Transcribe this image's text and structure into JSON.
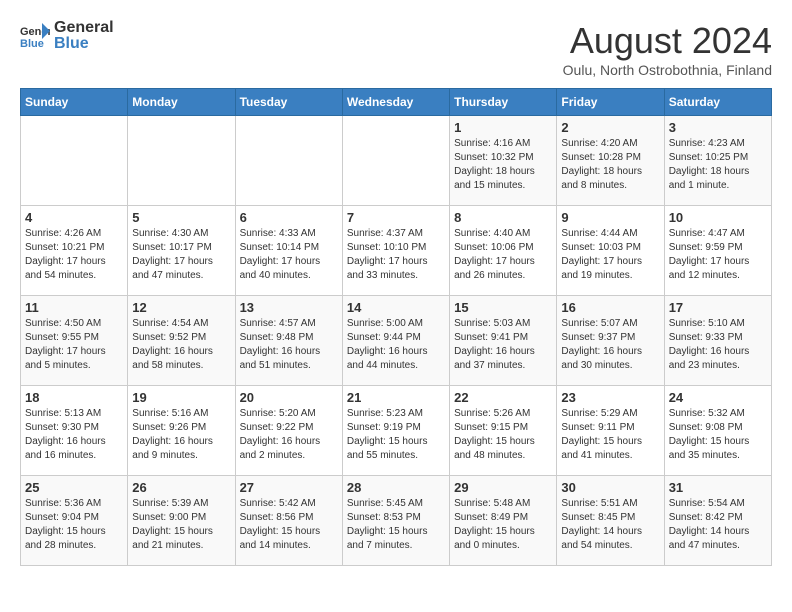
{
  "header": {
    "logo_general": "General",
    "logo_blue": "Blue",
    "title": "August 2024",
    "subtitle": "Oulu, North Ostrobothnia, Finland"
  },
  "weekdays": [
    "Sunday",
    "Monday",
    "Tuesday",
    "Wednesday",
    "Thursday",
    "Friday",
    "Saturday"
  ],
  "weeks": [
    [
      {
        "day": "",
        "info": ""
      },
      {
        "day": "",
        "info": ""
      },
      {
        "day": "",
        "info": ""
      },
      {
        "day": "",
        "info": ""
      },
      {
        "day": "1",
        "info": "Sunrise: 4:16 AM\nSunset: 10:32 PM\nDaylight: 18 hours\nand 15 minutes."
      },
      {
        "day": "2",
        "info": "Sunrise: 4:20 AM\nSunset: 10:28 PM\nDaylight: 18 hours\nand 8 minutes."
      },
      {
        "day": "3",
        "info": "Sunrise: 4:23 AM\nSunset: 10:25 PM\nDaylight: 18 hours\nand 1 minute."
      }
    ],
    [
      {
        "day": "4",
        "info": "Sunrise: 4:26 AM\nSunset: 10:21 PM\nDaylight: 17 hours\nand 54 minutes."
      },
      {
        "day": "5",
        "info": "Sunrise: 4:30 AM\nSunset: 10:17 PM\nDaylight: 17 hours\nand 47 minutes."
      },
      {
        "day": "6",
        "info": "Sunrise: 4:33 AM\nSunset: 10:14 PM\nDaylight: 17 hours\nand 40 minutes."
      },
      {
        "day": "7",
        "info": "Sunrise: 4:37 AM\nSunset: 10:10 PM\nDaylight: 17 hours\nand 33 minutes."
      },
      {
        "day": "8",
        "info": "Sunrise: 4:40 AM\nSunset: 10:06 PM\nDaylight: 17 hours\nand 26 minutes."
      },
      {
        "day": "9",
        "info": "Sunrise: 4:44 AM\nSunset: 10:03 PM\nDaylight: 17 hours\nand 19 minutes."
      },
      {
        "day": "10",
        "info": "Sunrise: 4:47 AM\nSunset: 9:59 PM\nDaylight: 17 hours\nand 12 minutes."
      }
    ],
    [
      {
        "day": "11",
        "info": "Sunrise: 4:50 AM\nSunset: 9:55 PM\nDaylight: 17 hours\nand 5 minutes."
      },
      {
        "day": "12",
        "info": "Sunrise: 4:54 AM\nSunset: 9:52 PM\nDaylight: 16 hours\nand 58 minutes."
      },
      {
        "day": "13",
        "info": "Sunrise: 4:57 AM\nSunset: 9:48 PM\nDaylight: 16 hours\nand 51 minutes."
      },
      {
        "day": "14",
        "info": "Sunrise: 5:00 AM\nSunset: 9:44 PM\nDaylight: 16 hours\nand 44 minutes."
      },
      {
        "day": "15",
        "info": "Sunrise: 5:03 AM\nSunset: 9:41 PM\nDaylight: 16 hours\nand 37 minutes."
      },
      {
        "day": "16",
        "info": "Sunrise: 5:07 AM\nSunset: 9:37 PM\nDaylight: 16 hours\nand 30 minutes."
      },
      {
        "day": "17",
        "info": "Sunrise: 5:10 AM\nSunset: 9:33 PM\nDaylight: 16 hours\nand 23 minutes."
      }
    ],
    [
      {
        "day": "18",
        "info": "Sunrise: 5:13 AM\nSunset: 9:30 PM\nDaylight: 16 hours\nand 16 minutes."
      },
      {
        "day": "19",
        "info": "Sunrise: 5:16 AM\nSunset: 9:26 PM\nDaylight: 16 hours\nand 9 minutes."
      },
      {
        "day": "20",
        "info": "Sunrise: 5:20 AM\nSunset: 9:22 PM\nDaylight: 16 hours\nand 2 minutes."
      },
      {
        "day": "21",
        "info": "Sunrise: 5:23 AM\nSunset: 9:19 PM\nDaylight: 15 hours\nand 55 minutes."
      },
      {
        "day": "22",
        "info": "Sunrise: 5:26 AM\nSunset: 9:15 PM\nDaylight: 15 hours\nand 48 minutes."
      },
      {
        "day": "23",
        "info": "Sunrise: 5:29 AM\nSunset: 9:11 PM\nDaylight: 15 hours\nand 41 minutes."
      },
      {
        "day": "24",
        "info": "Sunrise: 5:32 AM\nSunset: 9:08 PM\nDaylight: 15 hours\nand 35 minutes."
      }
    ],
    [
      {
        "day": "25",
        "info": "Sunrise: 5:36 AM\nSunset: 9:04 PM\nDaylight: 15 hours\nand 28 minutes."
      },
      {
        "day": "26",
        "info": "Sunrise: 5:39 AM\nSunset: 9:00 PM\nDaylight: 15 hours\nand 21 minutes."
      },
      {
        "day": "27",
        "info": "Sunrise: 5:42 AM\nSunset: 8:56 PM\nDaylight: 15 hours\nand 14 minutes."
      },
      {
        "day": "28",
        "info": "Sunrise: 5:45 AM\nSunset: 8:53 PM\nDaylight: 15 hours\nand 7 minutes."
      },
      {
        "day": "29",
        "info": "Sunrise: 5:48 AM\nSunset: 8:49 PM\nDaylight: 15 hours\nand 0 minutes."
      },
      {
        "day": "30",
        "info": "Sunrise: 5:51 AM\nSunset: 8:45 PM\nDaylight: 14 hours\nand 54 minutes."
      },
      {
        "day": "31",
        "info": "Sunrise: 5:54 AM\nSunset: 8:42 PM\nDaylight: 14 hours\nand 47 minutes."
      }
    ]
  ]
}
